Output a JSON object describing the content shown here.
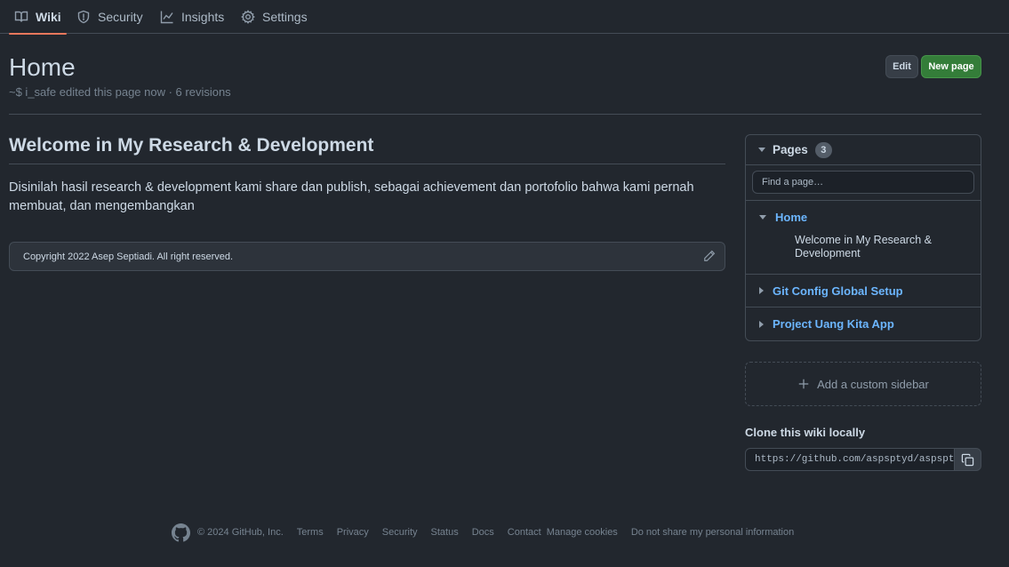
{
  "nav": {
    "tabs": [
      {
        "label": "Wiki",
        "icon": "book-icon",
        "active": true
      },
      {
        "label": "Security",
        "icon": "shield-icon",
        "active": false
      },
      {
        "label": "Insights",
        "icon": "graph-icon",
        "active": false
      },
      {
        "label": "Settings",
        "icon": "gear-icon",
        "active": false
      }
    ]
  },
  "header": {
    "title": "Home",
    "meta": "~$ i_safe edited this page now · 6 revisions",
    "edit_label": "Edit",
    "new_page_label": "New page"
  },
  "content": {
    "heading": "Welcome in My Research & Development",
    "paragraph": "Disinilah hasil research & development kami share dan publish, sebagai achievement dan portofolio bahwa kami pernah membuat, dan mengembangkan",
    "footer_text": "Copyright 2022 Asep Septiadi. All right reserved."
  },
  "sidebar": {
    "pages_label": "Pages",
    "pages_count": "3",
    "search_placeholder": "Find a page…",
    "pages": [
      {
        "label": "Home",
        "expanded": true,
        "subitems": [
          "Welcome in My Research & Development"
        ]
      },
      {
        "label": "Git Config Global Setup",
        "expanded": false
      },
      {
        "label": "Project Uang Kita App",
        "expanded": false
      }
    ],
    "add_sidebar_label": "Add a custom sidebar",
    "clone_title": "Clone this wiki locally",
    "clone_url": "https://github.com/aspsptyd/aspsptyd.wiki.git"
  },
  "footer": {
    "copyright": "© 2024 GitHub, Inc.",
    "links": [
      "Terms",
      "Privacy",
      "Security",
      "Status",
      "Docs",
      "Contact",
      "Manage cookies",
      "Do not share my personal information"
    ]
  },
  "colors": {
    "background": "#22272e",
    "accent_link": "#6cb6ff",
    "primary_button": "#347d39",
    "active_tab_underline": "#ec775c"
  }
}
